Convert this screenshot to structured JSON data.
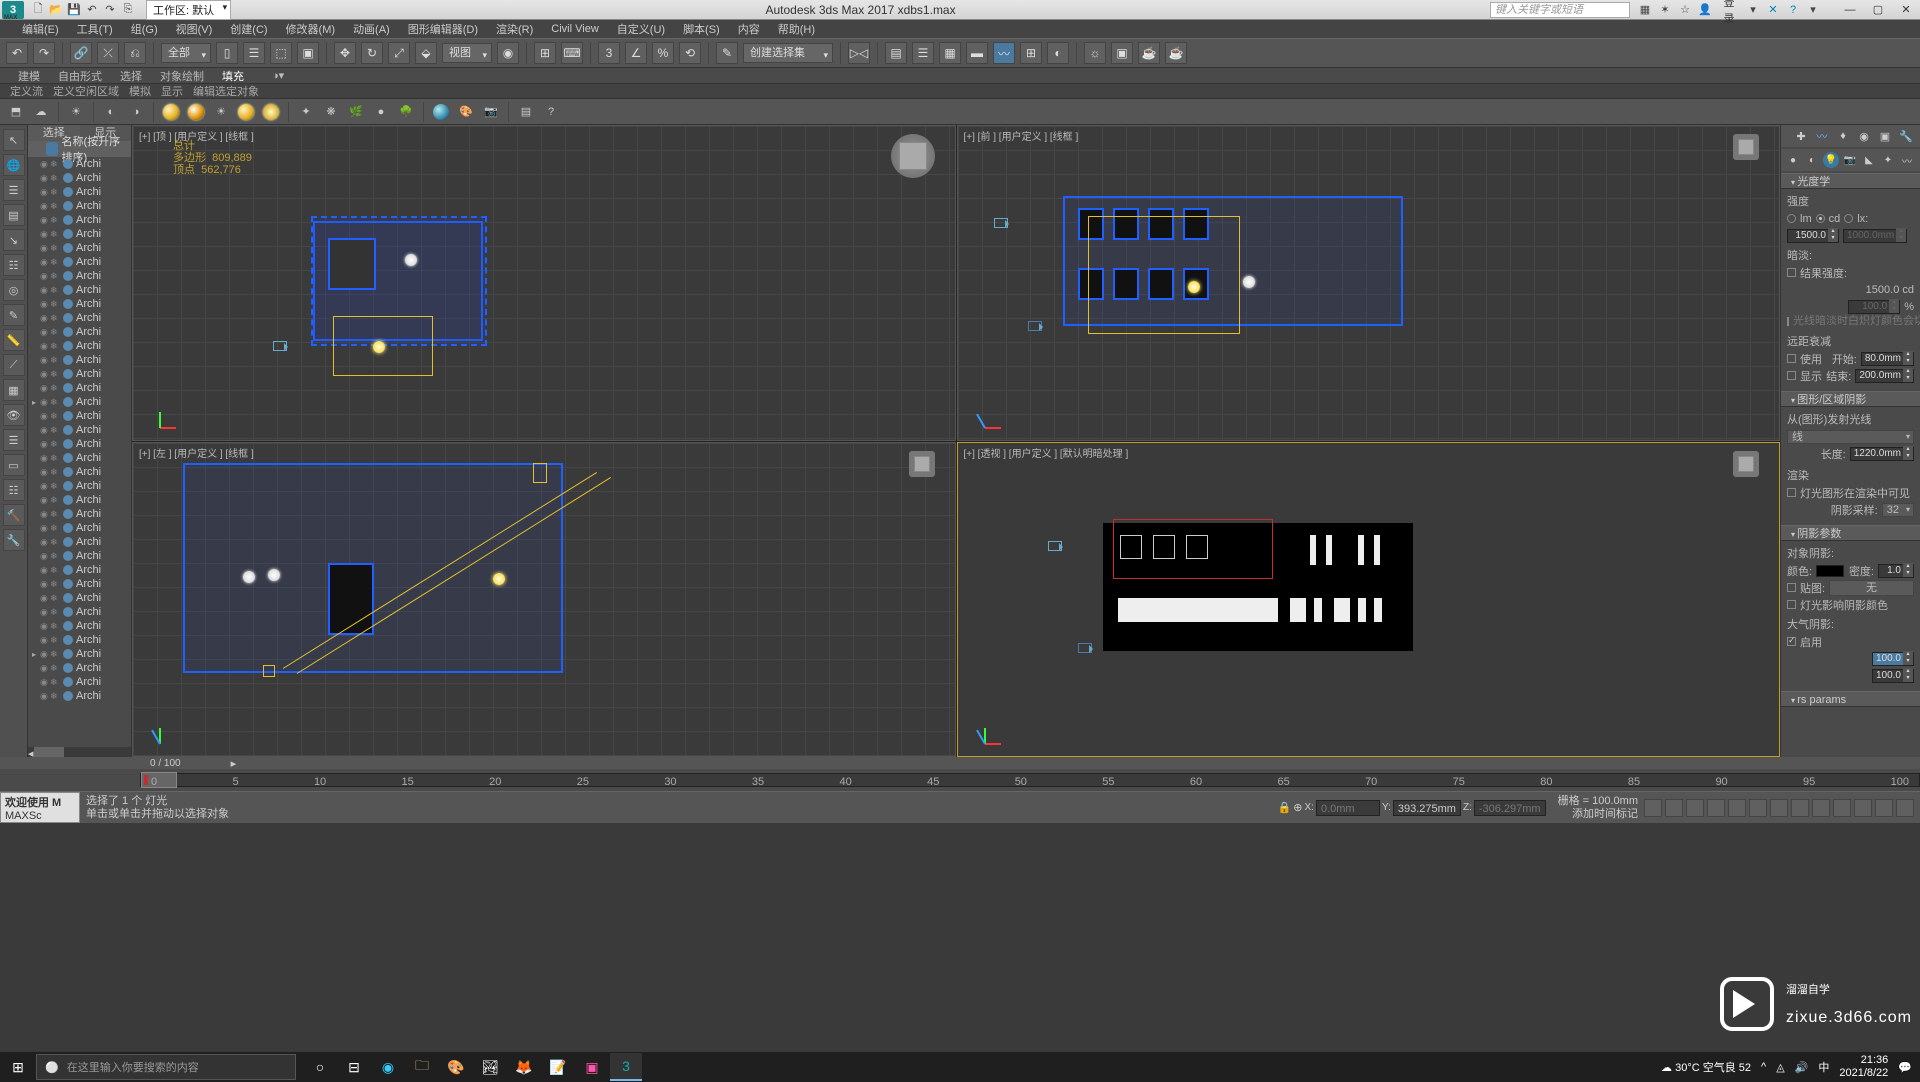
{
  "app": {
    "title": "Autodesk 3ds Max 2017    xdbs1.max",
    "workspace_label": "工作区: 默认",
    "search_placeholder": "键入关键字或短语",
    "signin": "登录"
  },
  "menus": [
    "编辑(E)",
    "工具(T)",
    "组(G)",
    "视图(V)",
    "创建(C)",
    "修改器(M)",
    "动画(A)",
    "图形编辑器(D)",
    "渲染(R)",
    "Civil View",
    "自定义(U)",
    "脚本(S)",
    "内容",
    "帮助(H)"
  ],
  "toolbar1": {
    "filter_all": "全部",
    "ref_coord": "视图",
    "selset": "创建选择集"
  },
  "ribbon": {
    "tabs": [
      "建模",
      "自由形式",
      "选择",
      "对象绘制",
      "填充"
    ],
    "sub": [
      "定义流",
      "定义空闲区域",
      "模拟",
      "显示",
      "编辑选定对象"
    ]
  },
  "scene": {
    "tabs": {
      "select": "选择",
      "display": "显示"
    },
    "sort_label": "名称(按升序排序)",
    "item_name": "Archi"
  },
  "viewports": {
    "top": "[+] [顶 ] [用户定义 ] [线框 ]",
    "front": "[+] [前 ] [用户定义 ] [线框 ]",
    "left": "[+] [左 ] [用户定义 ] [线框 ]",
    "persp": "[+] [透视 ] [用户定义 ] [默认明暗处理 ]",
    "stats": {
      "total": "总计",
      "polys_l": "多边形",
      "polys_v": "809,889",
      "verts_l": "顶点",
      "verts_v": "562,776"
    }
  },
  "cmd": {
    "rollout_intensity": "光度学",
    "intensity_label": "强度",
    "unit_lm": "lm",
    "unit_cd": "cd",
    "unit_lx": "lx:",
    "intensity_val": "1500.0",
    "intensity_at": "1000.0mm",
    "dimming": "暗淡:",
    "result_label": "结果强度:",
    "result_val": "1500.0 cd",
    "percent_val": "100.0",
    "percent_unit": "%",
    "incandescent": "光线暗淡时白炽灯颜色会切换",
    "far_atten": "远距衰减",
    "use": "使用",
    "start_l": "开始:",
    "start_v": "80.0mm",
    "show": "显示",
    "end_l": "结束:",
    "end_v": "200.0mm",
    "rollout_shape": "图形/区域阴影",
    "emit_from": "从(图形)发射光线",
    "shape_line": "线",
    "length_l": "长度:",
    "length_v": "1220.0mm",
    "render_head": "渲染",
    "visible_render": "灯光图形在渲染中可见",
    "shadow_samples_l": "阴影采样:",
    "shadow_samples_v": "32",
    "rollout_shadow": "阴影参数",
    "obj_shadow": "对象阴影:",
    "color_l": "颜色:",
    "density_l": "密度:",
    "density_v": "1.0",
    "map_l": "贴图:",
    "map_none": "无",
    "light_affects": "灯光影响阴影颜色",
    "atmos": "大气阴影:",
    "enable": "启用",
    "opacity_v": "100.0",
    "color_amt_v": "100.0",
    "rollout_rs": "rs params"
  },
  "timeline": {
    "progress": "0 / 100",
    "ticks": [
      "0",
      "5",
      "10",
      "15",
      "20",
      "25",
      "30",
      "35",
      "40",
      "45",
      "50",
      "55",
      "60",
      "65",
      "70",
      "75",
      "80",
      "85",
      "90",
      "95",
      "100"
    ]
  },
  "status": {
    "welcome1": "欢迎使用 M",
    "welcome2": "MAXSc",
    "msg1": "选择了 1 个 灯光",
    "msg2": "单击或单击并拖动以选择对象",
    "x": "0.0mm",
    "y": "393.275mm",
    "z": "-306.297mm",
    "grid": "栅格 = 100.0mm",
    "tag": "添加时间标记"
  },
  "watermark": {
    "text": "溜溜自学",
    "url": "zixue.3d66.com"
  },
  "taskbar": {
    "search": "在这里输入你要搜索的内容",
    "weather": "30°C 空气良 52",
    "time": "21:36",
    "date": "2021/8/22",
    "ime": "中"
  }
}
